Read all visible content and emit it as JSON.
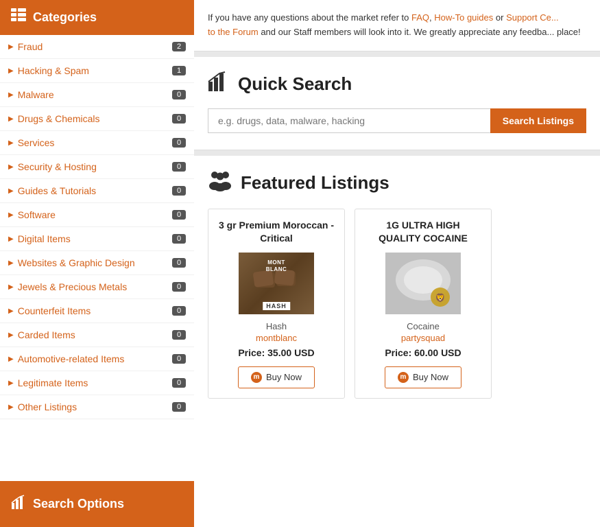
{
  "sidebar": {
    "header_label": "Categories",
    "footer_label": "Search Options",
    "categories": [
      {
        "id": "fraud",
        "label": "Fraud",
        "count": "2"
      },
      {
        "id": "hacking-spam",
        "label": "Hacking & Spam",
        "count": "1"
      },
      {
        "id": "malware",
        "label": "Malware",
        "count": "0"
      },
      {
        "id": "drugs-chemicals",
        "label": "Drugs & Chemicals",
        "count": "0"
      },
      {
        "id": "services",
        "label": "Services",
        "count": "0"
      },
      {
        "id": "security-hosting",
        "label": "Security & Hosting",
        "count": "0"
      },
      {
        "id": "guides-tutorials",
        "label": "Guides & Tutorials",
        "count": "0"
      },
      {
        "id": "software",
        "label": "Software",
        "count": "0"
      },
      {
        "id": "digital-items",
        "label": "Digital Items",
        "count": "0"
      },
      {
        "id": "websites-graphic-design",
        "label": "Websites & Graphic Design",
        "count": "0"
      },
      {
        "id": "jewels-precious-metals",
        "label": "Jewels & Precious Metals",
        "count": "0"
      },
      {
        "id": "counterfeit-items",
        "label": "Counterfeit Items",
        "count": "0"
      },
      {
        "id": "carded-items",
        "label": "Carded Items",
        "count": "0"
      },
      {
        "id": "automotive-related",
        "label": "Automotive-related Items",
        "count": "0"
      },
      {
        "id": "legitimate-items",
        "label": "Legitimate Items",
        "count": "0"
      },
      {
        "id": "other-listings",
        "label": "Other Listings",
        "count": "0"
      }
    ]
  },
  "info_banner": {
    "text_before": "If you have any questions about the market refer to ",
    "faq_link": "FAQ",
    "comma": ", ",
    "howto_link": "How-To guides",
    "or": " or ",
    "support_link": "Support Ce...",
    "text_middle": "to the Forum",
    "text_after": " and our Staff members will look into it. We greatly appreciate any feedba... place!"
  },
  "quick_search": {
    "title": "Quick Search",
    "placeholder": "e.g. drugs, data, malware, hacking",
    "button_label": "Search Listings"
  },
  "featured_listings": {
    "title": "Featured Listings",
    "listings": [
      {
        "id": "listing-1",
        "title": "3 gr Premium Moroccan - Critical",
        "image_type": "hash",
        "brand_line1": "MONT",
        "brand_line2": "BLANC",
        "hash_label": "HASH",
        "category": "Hash",
        "vendor": "montblanc",
        "price": "Price: 35.00 USD",
        "buy_label": "Buy Now"
      },
      {
        "id": "listing-2",
        "title": "1G ULTRA HIGH QUALITY COCAINE",
        "image_type": "cocaine",
        "category": "Cocaine",
        "vendor": "partysquad",
        "price": "Price: 60.00 USD",
        "buy_label": "Buy Now"
      }
    ]
  }
}
